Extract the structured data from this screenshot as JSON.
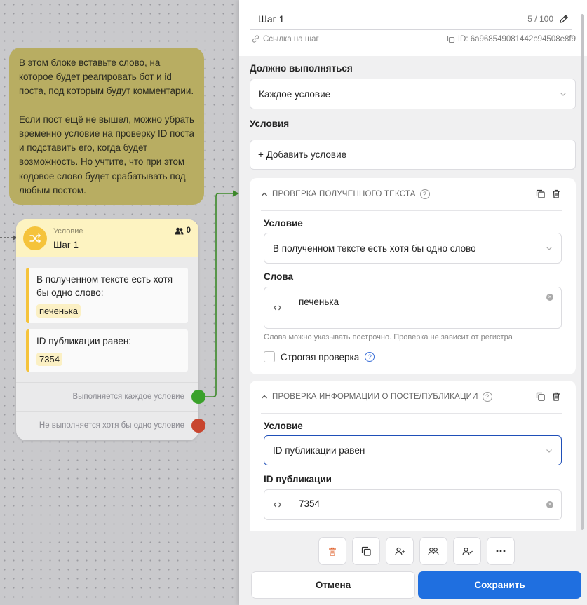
{
  "canvas": {
    "note_text": "В этом блоке вставьте слово, на которое будет реагировать бот и id поста, под которым будут комментарии.\n\nЕсли пост ещё не вышел, можно убрать временно условие на проверку ID поста и подставить его, когда будет возможность. Но учтите, что при этом кодовое слово будет срабатывать под любым постом.",
    "node": {
      "type_label": "Условие",
      "title": "Шаг 1",
      "subscriber_count": "0",
      "conditions": [
        {
          "text": "В полученном тексте есть хотя бы одно слово:",
          "value": "печенька"
        },
        {
          "text": "ID публикации равен:",
          "value": "7354"
        }
      ],
      "outputs": [
        {
          "label": "Выполняется каждое условие",
          "color": "#3aa12a"
        },
        {
          "label": "Не выполняется хотя бы одно условие",
          "color": "#c8452e"
        }
      ]
    }
  },
  "panel": {
    "title": "Шаг 1",
    "char_count": "5 / 100",
    "step_link": "Ссылка на шаг",
    "step_id": "ID: 6a968549081442b94508e8f9",
    "must_run_label": "Должно выполняться",
    "must_run_value": "Каждое условие",
    "conditions_label": "Условия",
    "add_condition": "+ Добавить условие",
    "card1": {
      "header": "ПРОВЕРКА ПОЛУЧЕННОГО ТЕКСТА",
      "condition_label": "Условие",
      "condition_value": "В полученном тексте есть хотя бы одно слово",
      "words_label": "Слова",
      "words_value": "печенька",
      "hint": "Слова можно указывать построчно. Проверка не зависит от регистра",
      "strict_label": "Строгая проверка"
    },
    "card2": {
      "header": "ПРОВЕРКА ИНФОРМАЦИИ О ПОСТЕ/ПУБЛИКАЦИИ",
      "condition_label": "Условие",
      "condition_value": "ID публикации равен",
      "post_id_label": "ID публикации",
      "post_id_value": "7354"
    },
    "cancel_label": "Отмена",
    "save_label": "Сохранить"
  },
  "colors": {
    "accent": "#1f6fe0",
    "note": "#b8ad62",
    "node_header": "#fdf3c1",
    "link_line": "#3d8a2a"
  }
}
